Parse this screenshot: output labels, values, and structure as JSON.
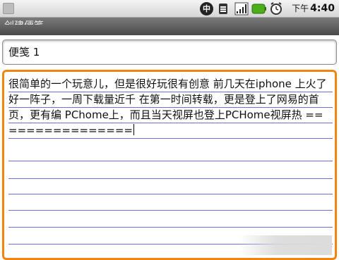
{
  "status_bar": {
    "china_icon_glyph": "中",
    "time_ampm": "下午",
    "time": "4:40",
    "icons": [
      "notification-icon",
      "china-mobile-icon",
      "signal-icon",
      "signal-bars-icon",
      "battery-icon",
      "alarm-icon"
    ],
    "battery_color": "#4caf1a"
  },
  "title_bar": {
    "title": "创建便笺"
  },
  "note": {
    "title_value": "便笺 1",
    "body_text": "很简单的一个玩意儿，但是很好玩很有创意 前几天在iphone 上火了好一阵子，一周下载量近千 在第一时间转载，更是登上了网易的首页，更有编 PChome上，而且当天视屏也登上PCHome视屏热 ================"
  },
  "colors": {
    "focus_border": "#f0840c",
    "rule_lines": "#6f6fd8"
  }
}
